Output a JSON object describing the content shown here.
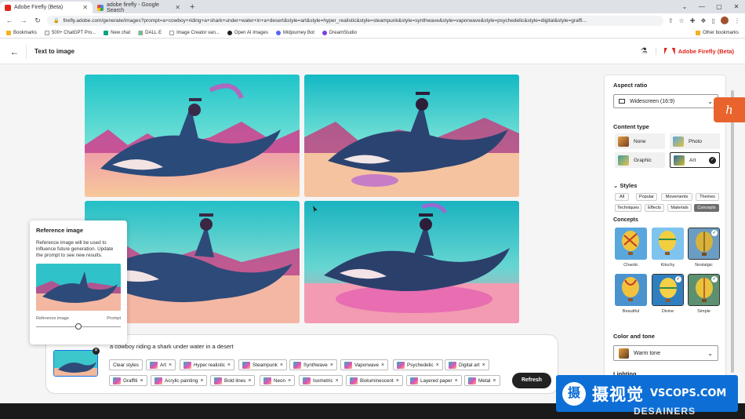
{
  "browser": {
    "tabs": [
      {
        "title": "Adobe Firefly (Beta)",
        "active": true
      },
      {
        "title": "adobe firefly - Google Search",
        "active": false
      }
    ],
    "new_tab": "+",
    "url": "firefly.adobe.com/generate/images?prompt=a+cowboy+riding+a+shark+under+water+in+a+desert&style=art&style=hyper_realistic&style=steampunk&style=synthwave&style=vaporwave&style=psychedelic&style=digital&style=graffi...",
    "bookmarks": [
      "Bookmarks",
      "500+ ChatGPT Pro...",
      "New chat",
      "DALL·E",
      "Image Creator van...",
      "Open AI Images",
      "Midjourney Bot",
      "DreamStudio"
    ],
    "other_bookmarks": "Other bookmarks"
  },
  "app": {
    "page_title": "Text to image",
    "brand": "Adobe Firefly (Beta)"
  },
  "reference_popover": {
    "title": "Reference image",
    "description": "Reference image will be used to influence future generation. Update the prompt to see new results.",
    "slider_left": "Reference image",
    "slider_right": "Prompt",
    "slider_value": 0.5
  },
  "prompt": {
    "text": "a cowboy riding a shark under water in a desert",
    "clear_styles": "Clear styles",
    "chips_row1": [
      "Art",
      "Hyper realistic",
      "Steampunk",
      "Synthwave",
      "Vaporwave",
      "Psychedelic",
      "Digital art"
    ],
    "chips_row2": [
      "Graffiti",
      "Acrylic painting",
      "Bold lines",
      "Neon",
      "Isometric",
      "Bioluminescent",
      "Layered paper",
      "Metal"
    ],
    "refresh": "Refresh"
  },
  "panel": {
    "aspect_ratio_label": "Aspect ratio",
    "aspect_ratio_value": "Widescreen (16:9)",
    "content_type_label": "Content type",
    "content_types": [
      "None",
      "Photo",
      "Graphic",
      "Art"
    ],
    "content_type_selected": "Art",
    "styles_label": "Styles",
    "style_tabs_row1": [
      "All",
      "Popular",
      "Movements",
      "Themes"
    ],
    "style_tabs_row2": [
      "Techniques",
      "Effects",
      "Materials",
      "Concepts"
    ],
    "style_tab_selected": "Concepts",
    "concepts_label": "Concepts",
    "concepts": [
      "Chaotic",
      "Kitschy",
      "Nostalgic",
      "Beautiful",
      "Divine",
      "Simple"
    ],
    "concepts_selected": [
      "Nostalgic",
      "Divine",
      "Simple"
    ],
    "color_tone_label": "Color and tone",
    "color_tone_value": "Warm tone",
    "lighting_label": "Lighting"
  },
  "watermark": {
    "logo_char": "摄",
    "cn": "摄视觉",
    "en": "VSCOPS.COM",
    "sub": "DESAINERS"
  },
  "colors": {
    "accent_red": "#e1251b",
    "refresh_bg": "#222222",
    "side_button": "#e8642c",
    "watermark_blue": "#0d6fd6"
  }
}
